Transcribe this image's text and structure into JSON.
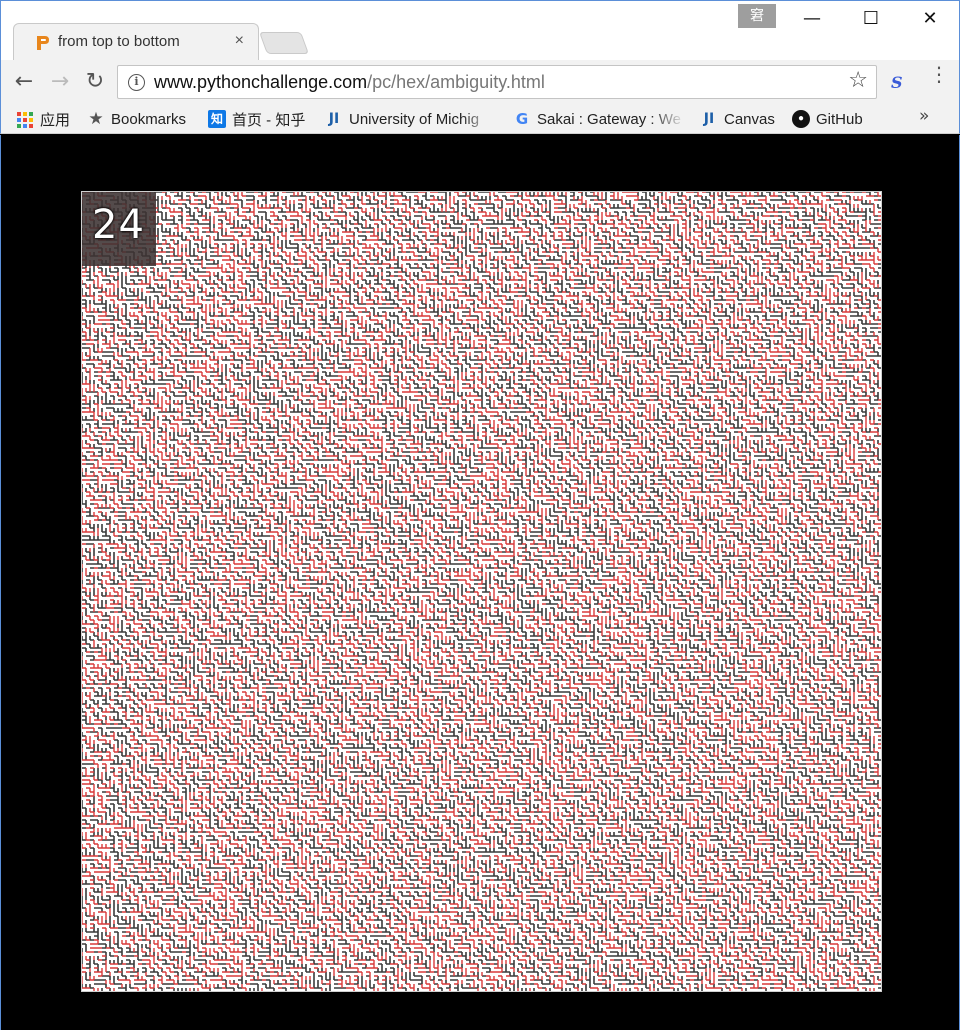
{
  "browser": {
    "tab_title": "from top to bottom",
    "tab_close": "×",
    "ime_indicator": "窘",
    "window_controls": {
      "minimize": "—",
      "maximize": "☐",
      "close": "✕"
    },
    "nav": {
      "back": "←",
      "forward": "→",
      "reload": "↻"
    },
    "url_host": "www.pythonchallenge.com",
    "url_path": "/pc/hex/ambiguity.html",
    "info_icon": "i",
    "bookmark_star": "☆",
    "extension_icon": "S",
    "menu_icon": "⋮",
    "bookmarks": [
      {
        "label": "应用",
        "icon": "apps-grid-icon"
      },
      {
        "label": "Bookmarks",
        "icon": "star-icon"
      },
      {
        "label": "首页 - 知乎",
        "icon": "zhihu-icon",
        "icon_text": "知"
      },
      {
        "label": "University of Michig",
        "icon": "ji-icon",
        "icon_text": "JI"
      },
      {
        "label": "Sakai : Gateway : We",
        "icon": "google-icon",
        "icon_text": "G"
      },
      {
        "label": "Canvas",
        "icon": "ji-icon",
        "icon_text": "JI"
      },
      {
        "label": "GitHub",
        "icon": "github-icon",
        "icon_text": "●"
      }
    ],
    "bookmarks_overflow": "»"
  },
  "page": {
    "level_number": "24",
    "maze_colors": {
      "background": "#ffffff",
      "wall_dark": "#3a3a3a",
      "wall_red": "#d83a3a"
    }
  }
}
